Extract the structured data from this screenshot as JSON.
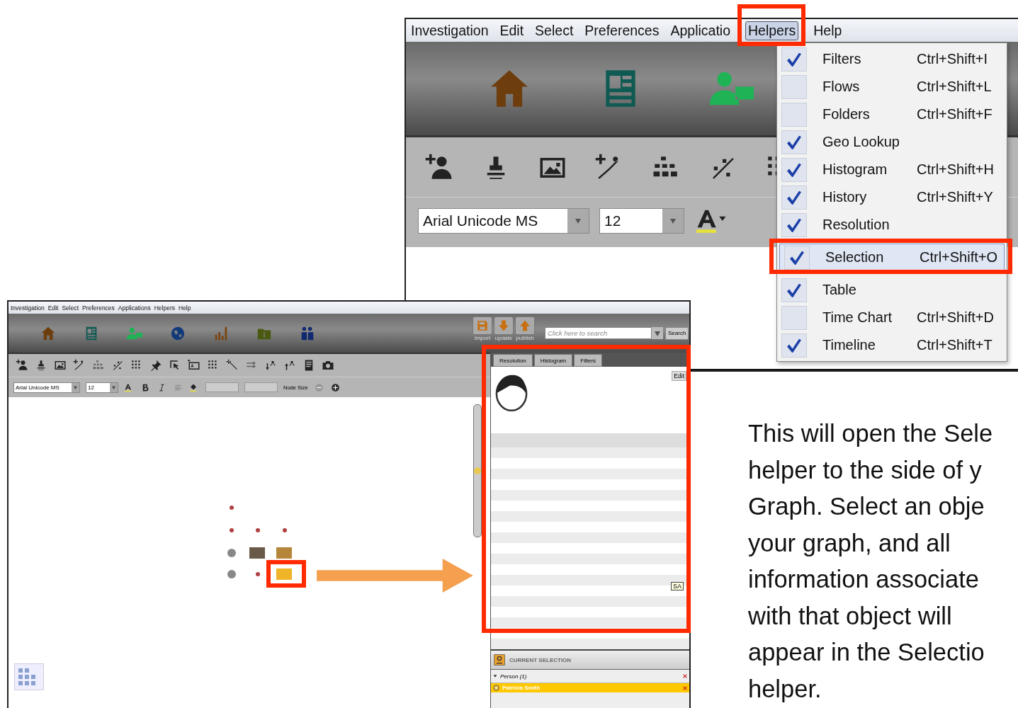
{
  "slide_text": [
    "This will open the Sele",
    "helper to the side of y",
    "Graph.  Select an obje",
    "your graph, and all",
    "information associate",
    "with that object will",
    "appear in the Selectio",
    "helper."
  ],
  "large_window": {
    "menu": [
      {
        "label": "Investigation",
        "selected": false
      },
      {
        "label": "Edit",
        "selected": false
      },
      {
        "label": "Select",
        "selected": false
      },
      {
        "label": "Preferences",
        "selected": false
      },
      {
        "label": "Applicatio",
        "selected": false
      },
      {
        "label": "Helpers",
        "selected": true
      },
      {
        "label": "Help",
        "selected": false
      }
    ],
    "font_field": "Arial Unicode MS",
    "size_field": "12"
  },
  "helpers_menu": [
    {
      "label": "Filters",
      "shortcut": "Ctrl+Shift+I",
      "checked": true,
      "selected": false
    },
    {
      "label": "Flows",
      "shortcut": "Ctrl+Shift+L",
      "checked": false,
      "selected": false
    },
    {
      "label": "Folders",
      "shortcut": "Ctrl+Shift+F",
      "checked": false,
      "selected": false
    },
    {
      "label": "Geo Lookup",
      "checked": true,
      "selected": false
    },
    {
      "label": "Histogram",
      "shortcut": "Ctrl+Shift+H",
      "checked": true,
      "selected": false
    },
    {
      "label": "History",
      "shortcut": "Ctrl+Shift+Y",
      "checked": true,
      "selected": false
    },
    {
      "label": "Resolution",
      "checked": true,
      "selected": false
    },
    {
      "label": "Selection",
      "shortcut": "Ctrl+Shift+O",
      "checked": true,
      "selected": true
    },
    {
      "label": "Table",
      "checked": true,
      "selected": false
    },
    {
      "label": "Time Chart",
      "shortcut": "Ctrl+Shift+D",
      "checked": false,
      "selected": false
    },
    {
      "label": "Timeline",
      "shortcut": "Ctrl+Shift+T",
      "checked": true,
      "selected": false
    }
  ],
  "small_window": {
    "menu": [
      "Investigation",
      "Edit",
      "Select",
      "Preferences",
      "Applications",
      "Helpers",
      "Help"
    ],
    "header_buttons": [
      "import",
      "update",
      "publish"
    ],
    "search": {
      "placeholder": "Click here to search"
    },
    "search_button": "Search",
    "font_field": "Arial Unicode MS",
    "size_field": "12",
    "node_size_label": "Node Size",
    "helper_tabs": [
      "Resolution",
      "Histogram",
      "Filters"
    ],
    "edit_button": "Edit",
    "tooltip": "SA",
    "zoom_slider": {
      "level": 0.5
    },
    "current_selection": {
      "title": "CURRENT SELECTION",
      "groups": [
        {
          "label": "Person (1)",
          "expanded": true,
          "items": [
            {
              "label": "Patricia Smith",
              "selected": true
            }
          ]
        }
      ]
    }
  }
}
